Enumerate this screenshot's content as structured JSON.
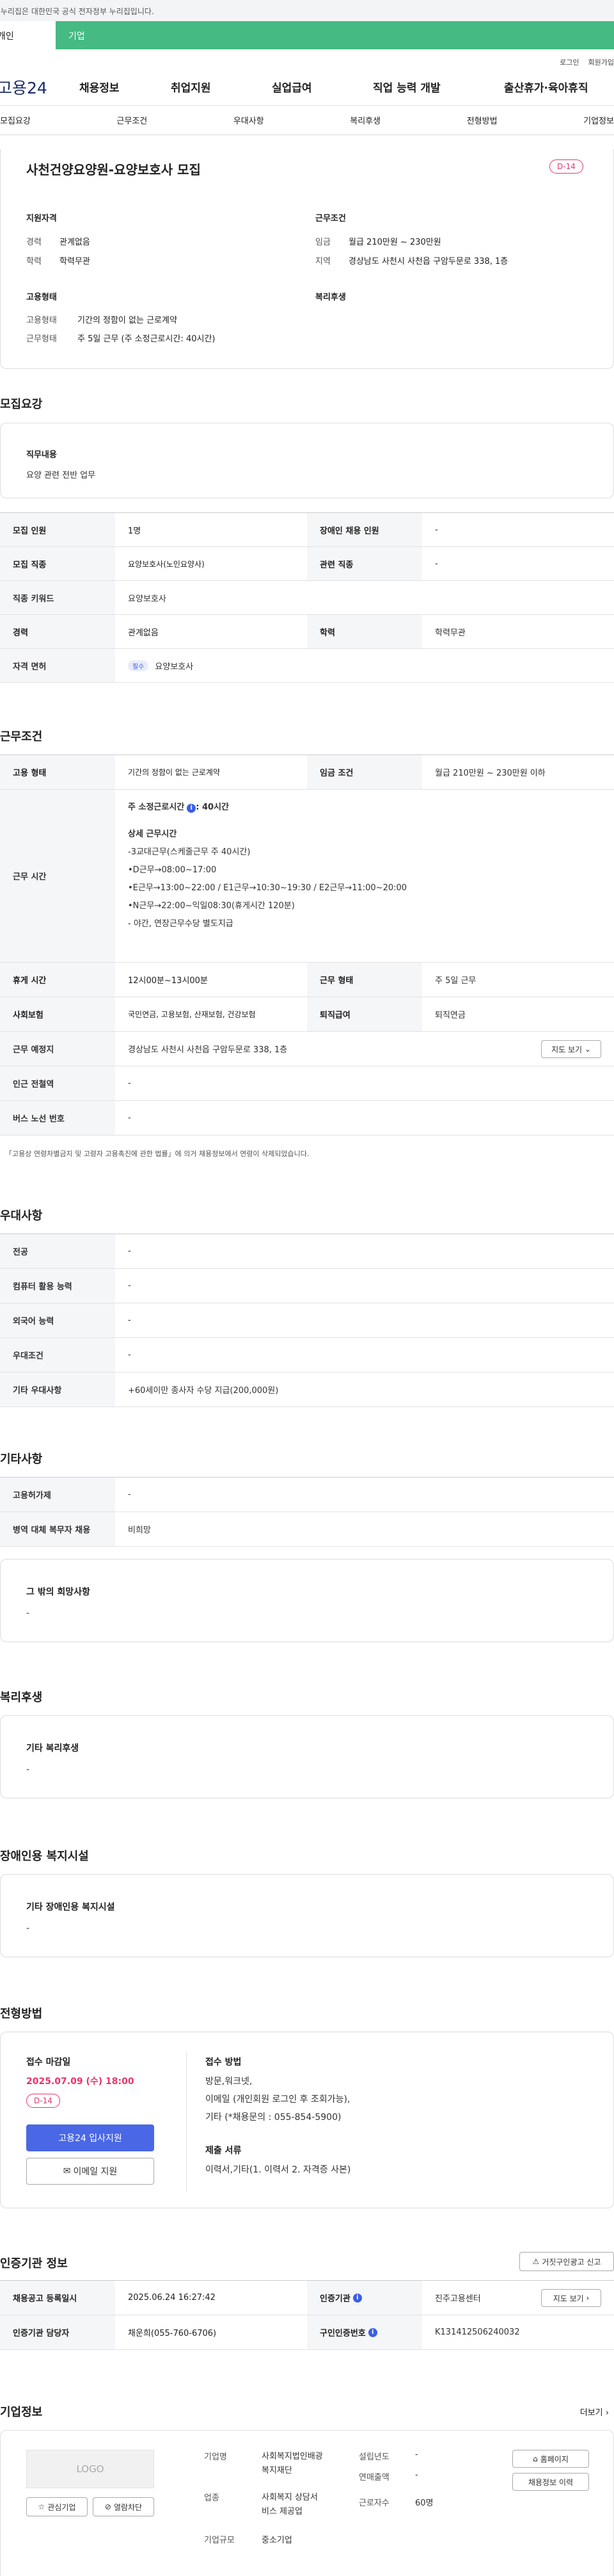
{
  "gov_banner": "이 누리집은 대한민국 공식 전자정부 누리집입니다.",
  "member_tabs": [
    "개인",
    "기업"
  ],
  "header_links": [
    "로그인",
    "회원가입"
  ],
  "brand": "고용24",
  "gnb": [
    "채용정보",
    "취업지원",
    "실업급여",
    "직업 능력 개발",
    "출산휴가·육아휴직"
  ],
  "anchors": [
    "모집요강",
    "근무조건",
    "우대사항",
    "복리후생",
    "전형방법",
    "기업정보"
  ],
  "job": {
    "title": "사천건양요양원-요양보호사 모집",
    "dday": "D-14",
    "qual_h": "지원자격",
    "cond_h": "근무조건",
    "emp_h": "고용형태",
    "welf_h": "복리후생",
    "career_k": "경력",
    "career_v": "관계없음",
    "edu_k": "학력",
    "edu_v": "학력무관",
    "wage_k": "임금",
    "wage_v": "월급 210만원 ~ 230만원",
    "loc_k": "지역",
    "loc_v": "경상남도 사천시 사천읍 구암두문로 338, 1층",
    "etype_k": "고용형태",
    "etype_v": "기간의 정함이 없는 근로계약",
    "wform_k": "근무형태",
    "wform_v": "주 5일 근무 (주 소정근로시간: 40시간)"
  },
  "recruit": {
    "heading": "모집요강",
    "duty_h": "직무내용",
    "duty_v": "요양 관련 전반 업무",
    "rows": [
      [
        "모집 인원",
        "1명",
        "장애인 채용 인원",
        "-"
      ],
      [
        "모집 직종",
        "요양보호사(노인요양사)",
        "관련 직종",
        "-"
      ]
    ],
    "kw_k": "직종 키워드",
    "kw_v": "요양보호사",
    "row3": [
      "경력",
      "관계없음",
      "학력",
      "학력무관"
    ],
    "lic_k": "자격 면허",
    "lic_tag": "필수",
    "lic_v": "요양보호사"
  },
  "work": {
    "heading": "근무조건",
    "r1": [
      "고용 형태",
      "기간의 정함이 없는 근로계약",
      "임금 조건",
      "월급 210만원 ~ 230만원 이하"
    ],
    "hours_k": "근무 시간",
    "hours_main": "주 소정근로시간",
    "hours_val": ": 40시간",
    "detail_h": "상세 근무시간",
    "detail": [
      "-3교대근무(스케줄근무 주 40시간)",
      "•D근무→08:00~17:00",
      "•E근무→13:00~22:00 / E1근무→10:30~19:30 / E2근무→11:00~20:00",
      "•N근무→22:00~익일08:30(휴게시간 120분)",
      "- 야간, 연장근무수당 별도지급"
    ],
    "r3": [
      "휴게 시간",
      "12시00분~13시00분",
      "근무 형태",
      "주 5일 근무"
    ],
    "r4": [
      "사회보험",
      "국민연금, 고용보험, 산재보험, 건강보험",
      "퇴직급여",
      "퇴직연금"
    ],
    "place_k": "근무 예정지",
    "place_v": "경상남도 사천시 사천읍 구암두문로 338, 1층",
    "map_btn": "지도 보기",
    "sub_k": "인근 전철역",
    "sub_v": "-",
    "bus_k": "버스 노선 번호",
    "bus_v": "-",
    "note": "「고용상 연령차별금지 및 고령자 고용촉진에 관한 법률」에 의거 채용정보에서 연령이 삭제되었습니다."
  },
  "pref": {
    "heading": "우대사항",
    "rows": [
      [
        "전공",
        "-"
      ],
      [
        "컴퓨터 활용 능력",
        "-"
      ],
      [
        "외국어 능력",
        "-"
      ],
      [
        "우대조건",
        "-"
      ],
      [
        "기타 우대사항",
        "+60세이만 종사자 수당 지급(200,000원)"
      ]
    ]
  },
  "etc": {
    "heading": "기타사항",
    "rows": [
      [
        "고용허가제",
        "-"
      ],
      [
        "병역 대체 복무자 채용",
        "비희망"
      ]
    ],
    "box_h": "그 밖의 희망사항",
    "box_v": "-"
  },
  "welfare": {
    "heading": "복리후생",
    "box_h": "기타 복리후생",
    "box_v": "-"
  },
  "disabled": {
    "heading": "장애인용 복지시설",
    "box_h": "기타 장애인용 복지시설",
    "box_v": "-"
  },
  "process": {
    "heading": "전형방법",
    "deadline_h": "접수 마감일",
    "deadline_v": "2025.07.09 (수) 18:00",
    "dday": "D-14",
    "apply_btn": "고용24 입사지원",
    "email_btn": "이메일 지원",
    "method_h": "접수 방법",
    "method": [
      "방문,워크넷,",
      "이메일 (개인회원 로그인 후 조회가능),",
      "기타 (*채용문의 : 055-854-5900)"
    ],
    "docs_h": "제출 서류",
    "docs_v": "이력서,기타(1. 이력서 2. 자격증 사본)"
  },
  "cert": {
    "heading": "인증기관 정보",
    "report_btn": "거짓구인광고 신고",
    "r1": [
      "채용공고 등록일시",
      "2025.06.24 16:27:42",
      "인증기관",
      "진주고용센터"
    ],
    "r2": [
      "인증기관 담당자",
      "채운희(055-760-6706)",
      "구인인증번호",
      "K131412506240032"
    ],
    "map_btn": "지도 보기"
  },
  "company": {
    "heading": "기업정보",
    "more": "더보기",
    "logo": "LOGO",
    "interest": "관심기업",
    "block": "열람차단",
    "name_k": "기업명",
    "name_v": [
      "사회복지법인배광",
      "복지재단"
    ],
    "found_k": "설립년도",
    "found_v": "-",
    "ind_k": "업종",
    "ind_v": [
      "사회복지 상담서",
      "비스 제공업"
    ],
    "sales_k": "연매출액",
    "sales_v": "-",
    "emp_k": "근로자수",
    "emp_v": "60명",
    "size_k": "기업규모",
    "size_v": "중소기업",
    "home_btn": "홈페이지",
    "history_btn": "채용정보 이력"
  },
  "colors": {
    "accent": "#3c5fe6",
    "green": "#45ba83",
    "dday": "#e6366d"
  }
}
